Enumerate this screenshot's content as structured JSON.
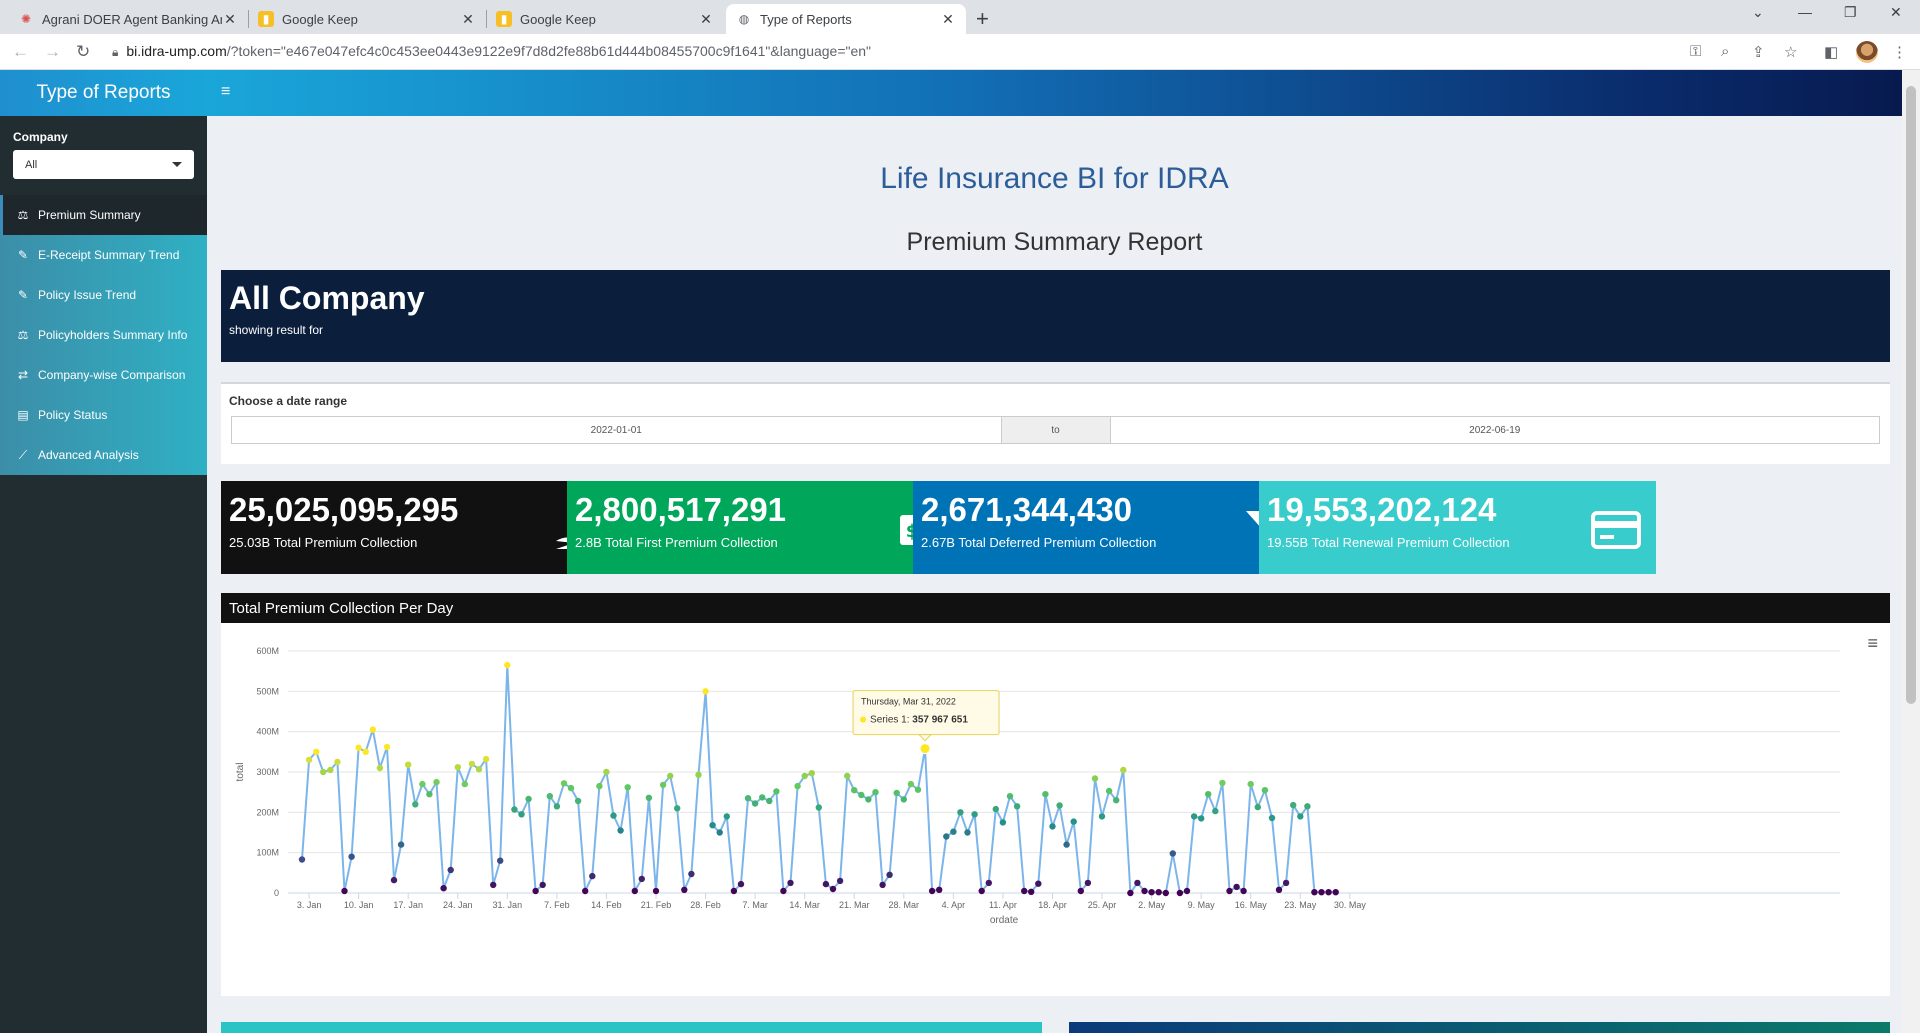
{
  "browser": {
    "tabs": [
      {
        "title": "Agrani DOER Agent Banking Ana",
        "icon": "pinwheel-icon"
      },
      {
        "title": "Google Keep",
        "icon": "keep-icon"
      },
      {
        "title": "Google Keep",
        "icon": "keep-icon"
      },
      {
        "title": "Type of Reports",
        "icon": "globe-icon"
      }
    ],
    "url_host": "bi.idra-ump.com",
    "url_rest": "/?token=\"e467e047efc4c0c453ee0443e9122e9f7d8d2fe88b61d444b08455700c9f1641\"&language=\"en\""
  },
  "sidebar": {
    "title": "Type of Reports",
    "company_label": "Company",
    "company_value": "All",
    "items": [
      {
        "label": "Premium Summary",
        "icon": "balance-icon"
      },
      {
        "label": "E-Receipt Summary Trend",
        "icon": "pen-icon"
      },
      {
        "label": "Policy Issue Trend",
        "icon": "pen-icon"
      },
      {
        "label": "Policyholders Summary Info",
        "icon": "scale-icon"
      },
      {
        "label": "Company-wise Comparison",
        "icon": "exchange-icon"
      },
      {
        "label": "Policy Status",
        "icon": "clipboard-icon"
      },
      {
        "label": "Advanced Analysis",
        "icon": "line-chart-icon"
      }
    ]
  },
  "main": {
    "title": "Life Insurance BI for IDRA",
    "subtitle": "Premium Summary Report",
    "banner_title": "All Company",
    "banner_sub": "showing result for",
    "date_label": "Choose a date range",
    "date_start": "2022-01-01",
    "date_to": "to",
    "date_end": "2022-06-19"
  },
  "value_boxes": [
    {
      "number": "25,025,095,295",
      "caption": "25.03B Total Premium Collection",
      "color": "#111111",
      "icon": "hand-dollar-icon"
    },
    {
      "number": "2,800,517,291",
      "caption": "2.8B Total First Premium Collection",
      "color": "#00a65a",
      "icon": "money-bill-icon"
    },
    {
      "number": "2,671,344,430",
      "caption": "2.67B Total Deferred Premium Collection",
      "color": "#0073b7",
      "icon": "funnel-dollar-icon"
    },
    {
      "number": "19,553,202,124",
      "caption": "19.55B Total Renewal Premium Collection",
      "color": "#39cccc",
      "icon": "credit-card-icon"
    }
  ],
  "chart_title": "Total Premium Collection Per Day",
  "chart_data": {
    "type": "line",
    "xlabel": "ordate",
    "ylabel": "total",
    "ylim": [
      0,
      600000000
    ],
    "y_ticks": [
      "0",
      "100M",
      "200M",
      "300M",
      "400M",
      "500M",
      "600M"
    ],
    "x_tick_labels": [
      "3. Jan",
      "10. Jan",
      "17. Jan",
      "24. Jan",
      "31. Jan",
      "7. Feb",
      "14. Feb",
      "21. Feb",
      "28. Feb",
      "7. Mar",
      "14. Mar",
      "21. Mar",
      "28. Mar",
      "4. Apr",
      "11. Apr",
      "18. Apr",
      "25. Apr",
      "2. May",
      "9. May",
      "16. May",
      "23. May",
      "30. May"
    ],
    "x_start": "2022-01-02",
    "grid": true,
    "line_color": "#7cb5ec",
    "series": [
      {
        "values": [
          83,
          330,
          350,
          300,
          305,
          325,
          5,
          90,
          360,
          350,
          405,
          310,
          362,
          32,
          120,
          318,
          220,
          270,
          245,
          275,
          12,
          57,
          312,
          270,
          320,
          307,
          332,
          20,
          80,
          565,
          207,
          195,
          233,
          5,
          20,
          240,
          215,
          272,
          260,
          228,
          5,
          42,
          265,
          300,
          192,
          155,
          262,
          5,
          35,
          236,
          5,
          268,
          290,
          210,
          8,
          47,
          293,
          500,
          168,
          150,
          190,
          5,
          22,
          235,
          222,
          237,
          228,
          252,
          5,
          25,
          265,
          290,
          297,
          212,
          22,
          10,
          30,
          290,
          255,
          243,
          232,
          250,
          20,
          45,
          248,
          232,
          270,
          256,
          358,
          5,
          8,
          140,
          152,
          200,
          150,
          195,
          5,
          25,
          208,
          175,
          240,
          215,
          5,
          3,
          23,
          245,
          165,
          217,
          120,
          177,
          5,
          25,
          284,
          190,
          253,
          230,
          305,
          0,
          25,
          5,
          2,
          2,
          0,
          98,
          0,
          5,
          190,
          185,
          245,
          203,
          273,
          5,
          15,
          5,
          270,
          213,
          255,
          186,
          8,
          25,
          218,
          190,
          215,
          2,
          2,
          2,
          2
        ]
      }
    ],
    "tooltip": {
      "date": "Thursday, Mar 31, 2022",
      "series": "Series 1",
      "value": "357 967 651"
    }
  }
}
